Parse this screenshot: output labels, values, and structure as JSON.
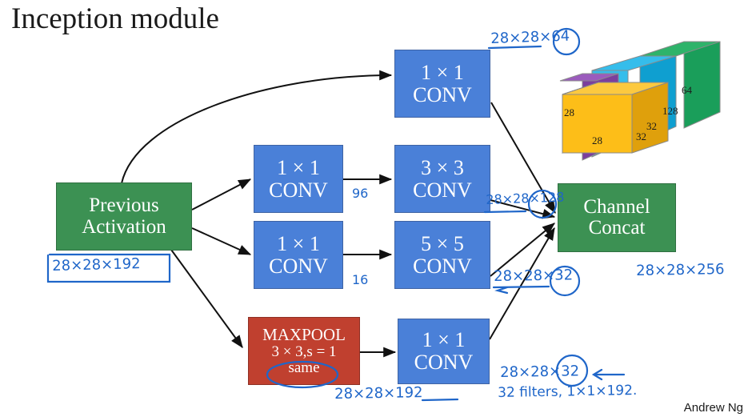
{
  "slide": {
    "title": "Inception module",
    "credit": "Andrew Ng"
  },
  "nodes": {
    "previous_activation": {
      "line1": "Previous",
      "line2": "Activation",
      "color": "#3c9153"
    },
    "conv1x1_top": {
      "line1": "1 × 1",
      "line2": "CONV",
      "color": "#4a80d8"
    },
    "conv1x1_a": {
      "line1": "1 × 1",
      "line2": "CONV",
      "color": "#4a80d8"
    },
    "conv3x3": {
      "line1": "3 × 3",
      "line2": "CONV",
      "color": "#4a80d8"
    },
    "conv1x1_b": {
      "line1": "1 × 1",
      "line2": "CONV",
      "color": "#4a80d8"
    },
    "conv5x5": {
      "line1": "5 × 5",
      "line2": "CONV",
      "color": "#4a80d8"
    },
    "maxpool": {
      "line1": "MAXPOOL",
      "line2": "3 × 3,s = 1",
      "line3": "same",
      "color": "#c0402f"
    },
    "conv1x1_pool": {
      "line1": "1 × 1",
      "line2": "CONV",
      "color": "#4a80d8"
    },
    "channel_concat": {
      "line1": "Channel",
      "line2": "Concat",
      "color": "#3c9153"
    }
  },
  "annotations": {
    "input_shape": "28×28×192",
    "out_1x1_top": "28×28×64",
    "filters_96": "96",
    "filters_16": "16",
    "out_3x3": "28×28×128",
    "out_5x5": "28×28×32",
    "pool_out": "28×28×192",
    "out_pool_conv": "28×28×32",
    "pool_conv_detail": "32 filters,  1×1×192.",
    "concat_out": "28×28×256",
    "ink_color": "#1f66c9"
  },
  "cube": {
    "labels": {
      "height_28": "28",
      "width_28": "28",
      "depth_32a": "32",
      "depth_32b": "32",
      "depth_128": "128",
      "depth_64": "64"
    },
    "colors": {
      "yellow": "#f7b718",
      "purple": "#7b3f9d",
      "cyan": "#35bdeb",
      "green": "#1a9e5a"
    }
  }
}
